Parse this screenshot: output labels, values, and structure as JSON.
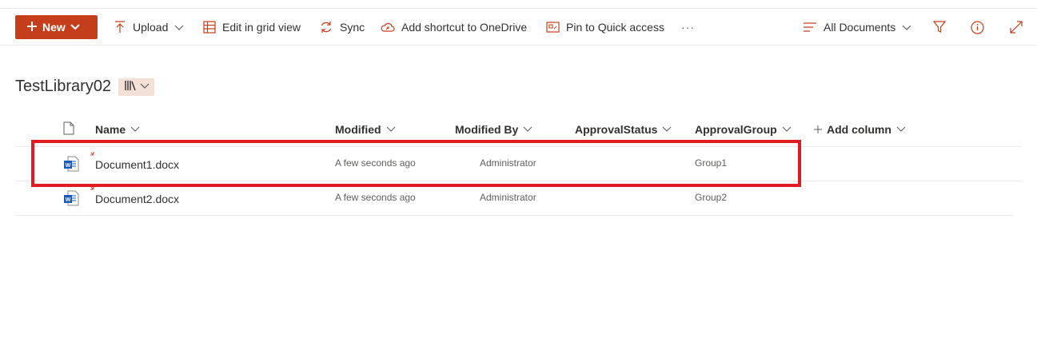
{
  "commandbar": {
    "new_label": "New",
    "upload_label": "Upload",
    "grid_label": "Edit in grid view",
    "sync_label": "Sync",
    "shortcut_label": "Add shortcut to OneDrive",
    "pin_label": "Pin to Quick access",
    "more_label": "···",
    "view_label": "All Documents"
  },
  "library": {
    "title": "TestLibrary02"
  },
  "columns": {
    "name": "Name",
    "modified": "Modified",
    "modified_by": "Modified By",
    "approval_status": "ApprovalStatus",
    "approval_group": "ApprovalGroup",
    "add_column": "Add column"
  },
  "rows": [
    {
      "name": "Document1.docx",
      "modified": "A few seconds ago",
      "modified_by": "Administrator",
      "approval_status": "",
      "approval_group": "Group1"
    },
    {
      "name": "Document2.docx",
      "modified": "A few seconds ago",
      "modified_by": "Administrator",
      "approval_status": "",
      "approval_group": "Group2"
    }
  ],
  "colors": {
    "accent": "#c43e1c",
    "highlight": "#e01b24",
    "word_blue": "#185abd"
  }
}
